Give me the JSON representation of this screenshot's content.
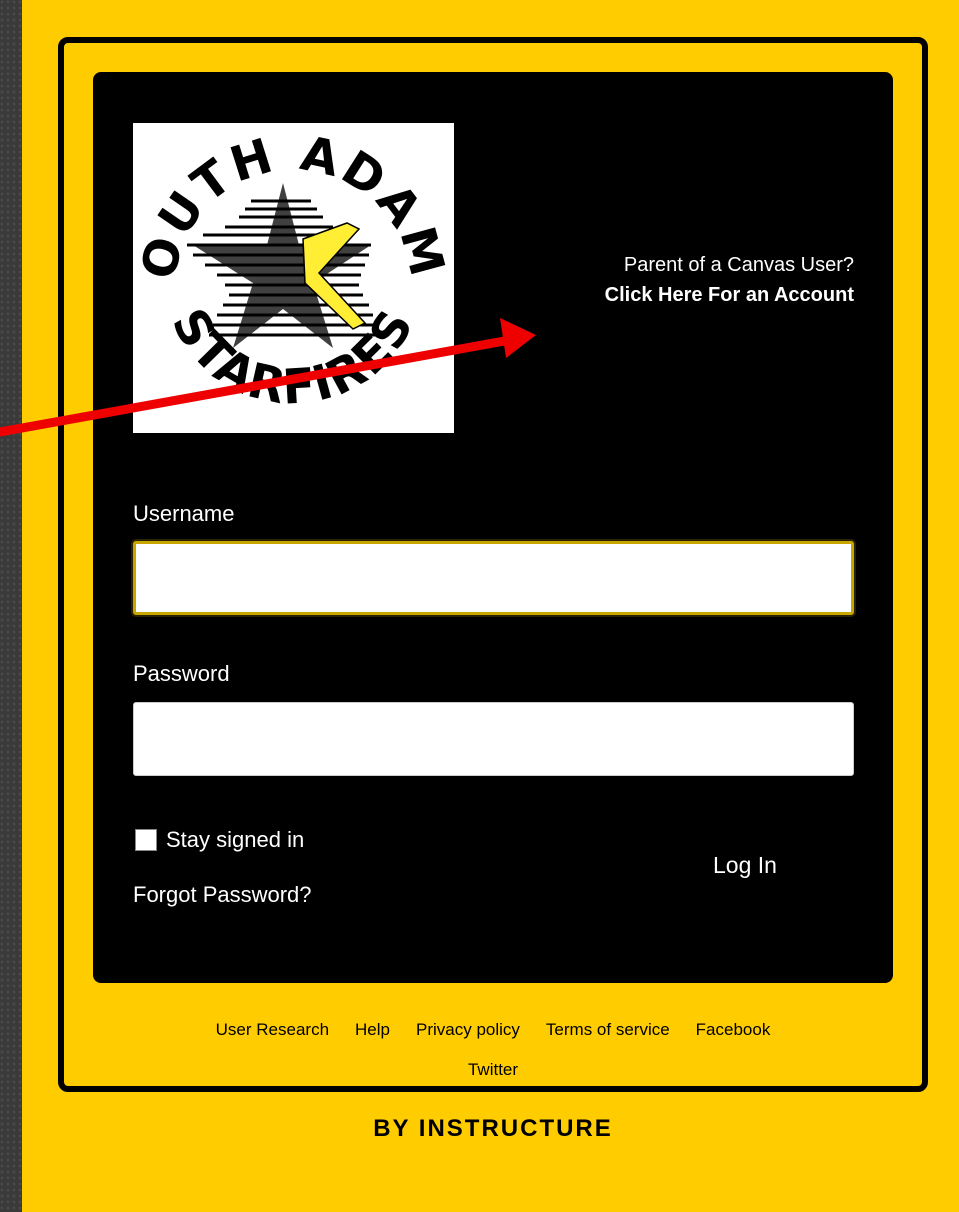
{
  "logo": {
    "top_text": "SOUTH ADAMS",
    "bottom_text": "STARFIRES",
    "icon": "star-logo-icon"
  },
  "parent": {
    "prompt": "Parent of a Canvas User?",
    "link": "Click Here For an Account"
  },
  "form": {
    "username_label": "Username",
    "username_value": "",
    "password_label": "Password",
    "password_value": "",
    "stay_signed_in": "Stay signed in",
    "stay_signed_in_checked": false,
    "forgot_password": "Forgot Password?",
    "login_button": "Log In"
  },
  "footer": {
    "links": [
      "User Research",
      "Help",
      "Privacy policy",
      "Terms of service",
      "Facebook"
    ],
    "second_row_link": "Twitter",
    "brand": "BY INSTRUCTURE"
  },
  "colors": {
    "brand_yellow": "#ffcc00",
    "panel_black": "#000000",
    "annotation_arrow": "#ee0000"
  }
}
